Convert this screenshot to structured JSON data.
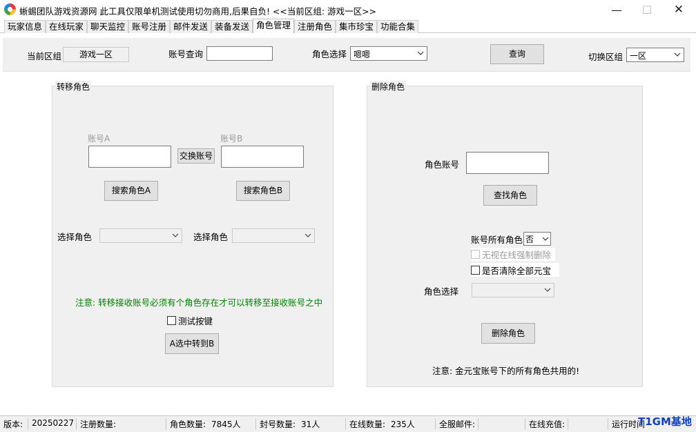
{
  "window": {
    "title": "蜥蜴团队游戏资源网 此工具仅限单机测试使用切勿商用,后果自负! <<当前区组: 游戏一区>>",
    "min_glyph": "—",
    "max_glyph": "☐",
    "close_glyph": "✕"
  },
  "tabs": [
    {
      "label": "玩家信息"
    },
    {
      "label": "在线玩家"
    },
    {
      "label": "聊天监控"
    },
    {
      "label": "账号注册"
    },
    {
      "label": "邮件发送"
    },
    {
      "label": "装备发送"
    },
    {
      "label": "角色管理",
      "active": true
    },
    {
      "label": "注册角色"
    },
    {
      "label": "集市珍宝"
    },
    {
      "label": "功能合集"
    }
  ],
  "toolbar": {
    "current_zone_label": "当前区组",
    "current_zone_value": "游戏一区",
    "account_query_label": "账号查询",
    "account_query_value": "",
    "role_select_label": "角色选择",
    "role_select_value": "嗯嗯",
    "query_button": "查询",
    "switch_zone_label": "切换区组",
    "switch_zone_value": "一区"
  },
  "transfer": {
    "title": "转移角色",
    "account_a_label": "账号A",
    "account_b_label": "账号B",
    "account_a_value": "",
    "account_b_value": "",
    "swap_button": "交换账号",
    "search_a_button": "搜索角色A",
    "search_b_button": "搜索角色B",
    "select_role_label_a": "选择角色",
    "select_role_label_b": "选择角色",
    "notice": "注意: 转移接收账号必须有个角色存在才可以转移至接收账号之中",
    "test_checkbox": "测试按键",
    "transfer_button": "A选中转到B"
  },
  "delete": {
    "title": "删除角色",
    "role_account_label": "角色账号",
    "role_account_value": "",
    "find_button": "查找角色",
    "all_roles_label": "账号所有角色",
    "all_roles_value": "否",
    "ignore_online_checkbox": "无视在线强制删除",
    "clear_gold_checkbox": "是否清除全部元宝",
    "role_select_label": "角色选择",
    "delete_button": "删除角色",
    "notice": "注意: 金元宝账号下的所有角色共用的!"
  },
  "status": {
    "version_label": "版本:",
    "version_value": "20250227",
    "register_count_label": "注册数量:",
    "role_count_label": "角色数量:",
    "role_count_value": "7845人",
    "banned_count_label": "封号数量:",
    "banned_count_value": "31人",
    "online_count_label": "在线数量:",
    "online_count_value": "235人",
    "server_mail_label": "全服邮件:",
    "online_recharge_label": "在线充值:",
    "runtime_label": "运行时间"
  },
  "watermark": "T1GM基地",
  "colors": {
    "notice_green": "#008000",
    "watermark_blue": "#1040c0"
  }
}
